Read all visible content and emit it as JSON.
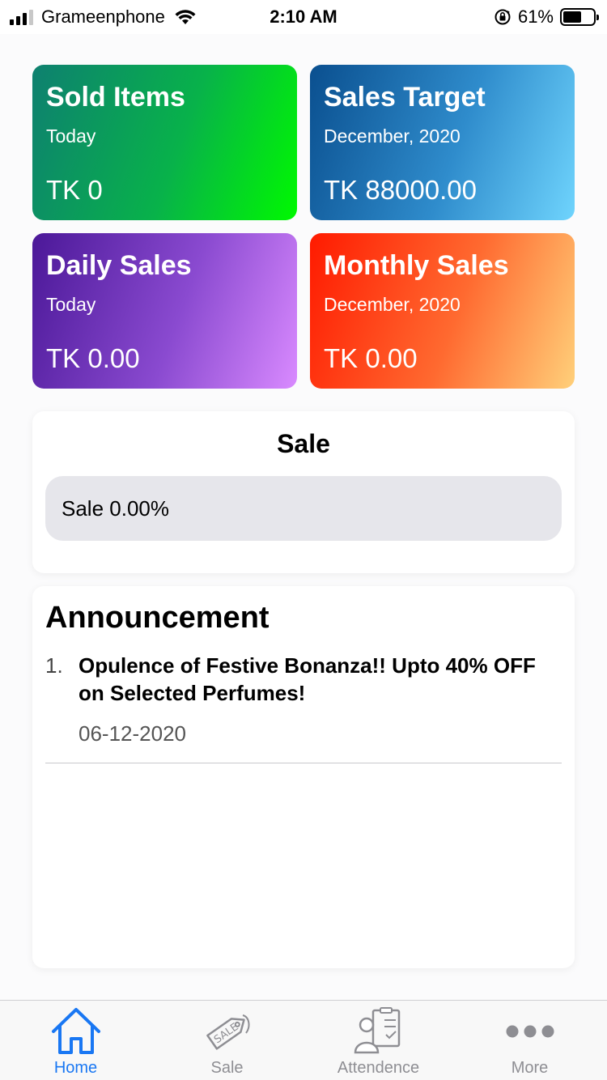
{
  "status_bar": {
    "carrier": "Grameenphone",
    "time": "2:10 AM",
    "battery": "61%",
    "battery_level": 0.61,
    "signal_icon": "cellular-signal-icon",
    "wifi_icon": "wifi-icon",
    "rotation_lock_icon": "rotation-lock-icon"
  },
  "cards": {
    "sold_items": {
      "title": "Sold Items",
      "subtitle": "Today",
      "value": "TK 0"
    },
    "sales_target": {
      "title": "Sales Target",
      "subtitle": "December, 2020",
      "value": "TK 88000.00"
    },
    "daily_sales": {
      "title": "Daily Sales",
      "subtitle": "Today",
      "value": "TK 0.00"
    },
    "monthly_sales": {
      "title": "Monthly Sales",
      "subtitle": "December, 2020",
      "value": "TK 0.00"
    }
  },
  "sale": {
    "title": "Sale",
    "progress_text": "Sale 0.00%",
    "progress_fraction": 0.0
  },
  "announcement": {
    "title": "Announcement",
    "items": [
      {
        "number": "1.",
        "text": "Opulence of Festive Bonanza!! Upto 40% OFF on Selected Perfumes!",
        "date": "06-12-2020"
      }
    ]
  },
  "tabs": [
    {
      "label": "Home",
      "icon": "home-icon",
      "active": true
    },
    {
      "label": "Sale",
      "icon": "sale-tag-icon",
      "active": false
    },
    {
      "label": "Attendence",
      "icon": "attendance-clipboard-icon",
      "active": false
    },
    {
      "label": "More",
      "icon": "more-dots-icon",
      "active": false
    }
  ],
  "colors": {
    "accent": "#1977f3",
    "tab_inactive": "#8e8e93"
  }
}
